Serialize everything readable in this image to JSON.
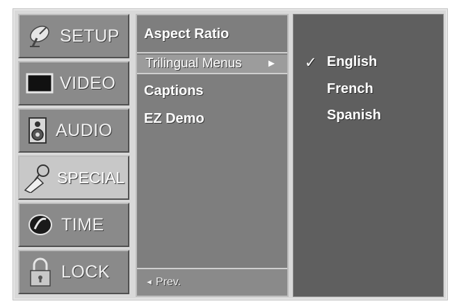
{
  "tabs": [
    {
      "label": "SETUP",
      "icon": "satellite-dish-icon"
    },
    {
      "label": "VIDEO",
      "icon": "tv-screen-icon"
    },
    {
      "label": "AUDIO",
      "icon": "speaker-icon"
    },
    {
      "label": "SPECIAL",
      "icon": "magic-wand-icon",
      "active": true
    },
    {
      "label": "TIME",
      "icon": "clock-icon"
    },
    {
      "label": "LOCK",
      "icon": "padlock-icon"
    }
  ],
  "menu": {
    "items": [
      "Aspect Ratio",
      "Trilingual Menus",
      "Captions",
      "EZ Demo"
    ],
    "selected_arrow": "►",
    "prev_label": "Prev.",
    "prev_arrow": "◄"
  },
  "submenu": {
    "options": [
      "English",
      "French",
      "Spanish"
    ],
    "checked_mark": "✓"
  },
  "colors": {
    "tab_bg": "#8a8a8a",
    "tab_active_bg": "#c8c8c8",
    "menu_bg": "#7e7e7e",
    "submenu_bg": "#5f5f5f"
  }
}
